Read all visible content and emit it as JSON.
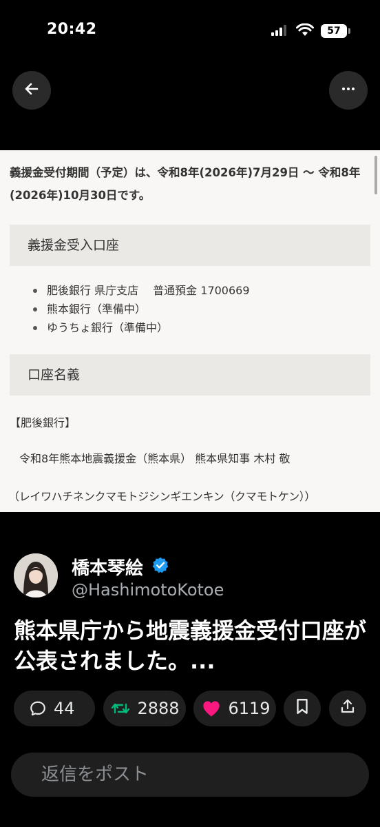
{
  "status_bar": {
    "time": "20:42",
    "battery": "57"
  },
  "nav": {
    "back_icon": "arrow-left-icon",
    "more_icon": "more-horizontal-icon"
  },
  "media": {
    "period_text": "義援金受付期間（予定）は、令和8年(2026年)7月29日 ～ 令和8年(2026年)10月30日です。",
    "account_heading": "義援金受入口座",
    "banks": [
      "肥後銀行  県庁支店　 普通預金  1700669",
      "熊本銀行（準備中）",
      "ゆうちょ銀行（準備中）"
    ],
    "holder_heading": "口座名義",
    "holder_bank_label": "【肥後銀行】",
    "holder_name": "令和8年熊本地震義援金（熊本県） 熊本県知事  木村  敬",
    "holder_kana": "（レイワハチネンクマモトジシンギエンキン（クマモトケン））"
  },
  "tweet": {
    "display_name": "橋本琴絵",
    "handle": "@HashimotoKotoe",
    "text": "熊本県庁から地震義援金受付口座が公表されました。...",
    "verified_color": "#1d9bf0"
  },
  "actions": {
    "replies": "44",
    "retweets": "2888",
    "likes": "6119",
    "retweet_color": "#00ba7c",
    "like_color": "#f91880"
  },
  "reply_box": {
    "placeholder": "返信をポスト"
  }
}
